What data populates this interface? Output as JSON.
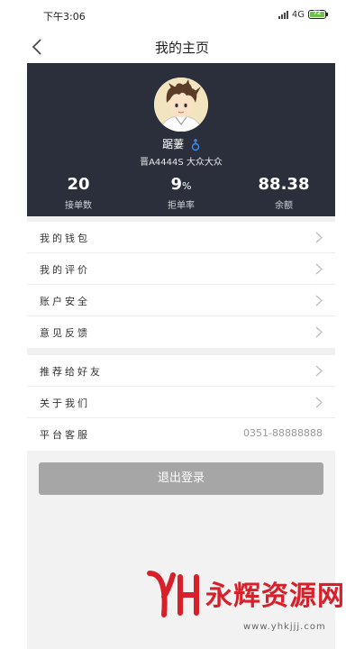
{
  "status_bar": {
    "time": "下午3:06",
    "network": "4G",
    "battery_level": "72"
  },
  "nav": {
    "title": "我的主页"
  },
  "profile": {
    "name": "踞萋",
    "car_info": "晋A4444S 大众大众",
    "stats": [
      {
        "value": "20",
        "unit": "",
        "label": "接单数"
      },
      {
        "value": "9",
        "unit": "%",
        "label": "拒单率"
      },
      {
        "value": "88.38",
        "unit": "",
        "label": "余额"
      }
    ]
  },
  "menu_group_1": [
    {
      "label": "我的钱包"
    },
    {
      "label": "我的评价"
    },
    {
      "label": "账户安全"
    },
    {
      "label": "意见反馈"
    }
  ],
  "menu_group_2": [
    {
      "label": "推荐给好友"
    },
    {
      "label": "关于我们"
    },
    {
      "label": "平台客服",
      "value": "0351-88888888"
    }
  ],
  "logout_label": "退出登录",
  "watermark": {
    "name": "永辉资源网",
    "url": "www.yhkjjj.com"
  },
  "colors": {
    "header_bg": "#2b2f3b",
    "logout_bg": "#a6a6a6",
    "gender_icon": "#3d8ef0",
    "watermark": "#d8202a"
  },
  "icons": {
    "back": "chevron-left-icon",
    "gender": "male-gender-icon",
    "row_arrow": "chevron-right-icon"
  }
}
